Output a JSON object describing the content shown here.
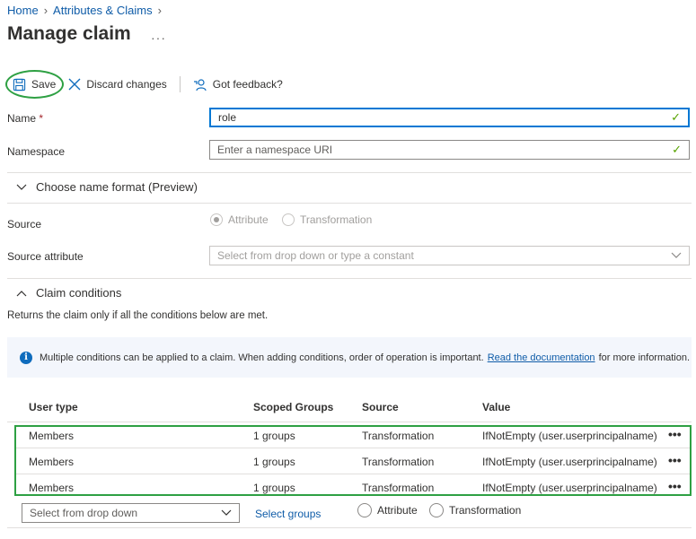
{
  "breadcrumb": {
    "items": [
      "Home",
      "Attributes & Claims"
    ]
  },
  "page": {
    "title": "Manage claim",
    "more": "···"
  },
  "toolbar": {
    "save_label": "Save",
    "discard_label": "Discard changes",
    "feedback_label": "Got feedback?"
  },
  "form": {
    "name_label": "Name",
    "name_required": "*",
    "name_value": "role",
    "namespace_label": "Namespace",
    "namespace_placeholder": "Enter a namespace URI",
    "name_format_toggle": "Choose name format (Preview)",
    "source_label": "Source",
    "source_options": [
      "Attribute",
      "Transformation"
    ],
    "source_selected": "Attribute",
    "source_attribute_label": "Source attribute",
    "source_attribute_placeholder": "Select from drop down or type a constant"
  },
  "conditions": {
    "header": "Claim conditions",
    "description": "Returns the claim only if all the conditions below are met.",
    "info_text": "Multiple conditions can be applied to a claim.  When adding conditions, order of operation is important.",
    "info_link": "Read the documentation",
    "info_suffix": "for more information.",
    "columns": [
      "User type",
      "Scoped Groups",
      "Source",
      "Value"
    ],
    "rows": [
      {
        "user_type": "Members",
        "groups": "1 groups",
        "source": "Transformation",
        "value": "IfNotEmpty (user.userprincipalname)"
      },
      {
        "user_type": "Members",
        "groups": "1 groups",
        "source": "Transformation",
        "value": "IfNotEmpty (user.userprincipalname)"
      },
      {
        "user_type": "Members",
        "groups": "1 groups",
        "source": "Transformation",
        "value": "IfNotEmpty (user.userprincipalname)"
      }
    ],
    "row_more": "•••",
    "new_row": {
      "user_type_placeholder": "Select from drop down",
      "select_groups": "Select groups",
      "source_options": [
        "Attribute",
        "Transformation"
      ]
    }
  },
  "colors": {
    "accent": "#0078d4",
    "link": "#0f5ca8",
    "highlight": "#2ea043",
    "check": "#57a300"
  }
}
